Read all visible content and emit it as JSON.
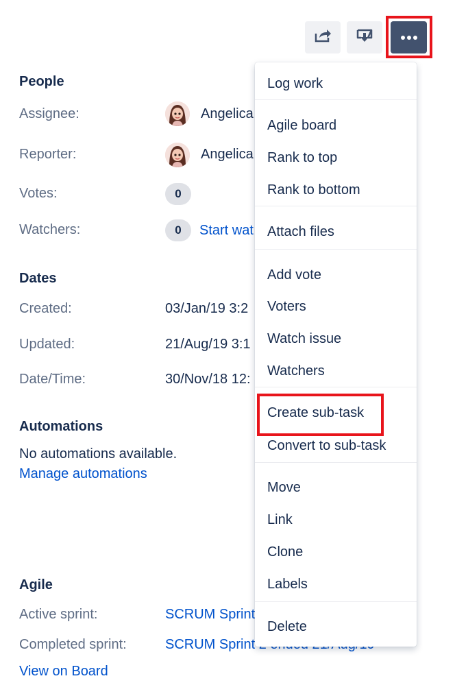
{
  "toolbar": {
    "share_icon": "share-icon",
    "export_icon": "export-icon",
    "more_icon": "more-icon"
  },
  "people": {
    "title": "People",
    "assignee_label": "Assignee:",
    "assignee_name": "Angelica",
    "reporter_label": "Reporter:",
    "reporter_name": "Angelica",
    "votes_label": "Votes:",
    "votes_count": "0",
    "watchers_label": "Watchers:",
    "watchers_count": "0",
    "start_watching": "Start wat"
  },
  "dates": {
    "title": "Dates",
    "created_label": "Created:",
    "created_value": "03/Jan/19 3:2",
    "updated_label": "Updated:",
    "updated_value": "21/Aug/19 3:1",
    "datetime_label": "Date/Time:",
    "datetime_value": "30/Nov/18 12:"
  },
  "automations": {
    "title": "Automations",
    "empty_text": "No automations available.",
    "manage_link": "Manage automations"
  },
  "agile": {
    "title": "Agile",
    "active_label": "Active sprint:",
    "active_value": "SCRUM Sprint",
    "completed_label": "Completed sprint:",
    "completed_value": "SCRUM Sprint 2 ended 21/Aug/19",
    "view_board": "View on Board"
  },
  "menu": {
    "items": [
      "Log work",
      "Agile board",
      "Rank to top",
      "Rank to bottom",
      "Attach files",
      "Add vote",
      "Voters",
      "Watch issue",
      "Watchers",
      "Create sub-task",
      "Convert to sub-task",
      "Move",
      "Link",
      "Clone",
      "Labels",
      "Delete"
    ]
  },
  "colors": {
    "highlight": "#e8141b",
    "link": "#0052cc",
    "more_button": "#42526e"
  }
}
